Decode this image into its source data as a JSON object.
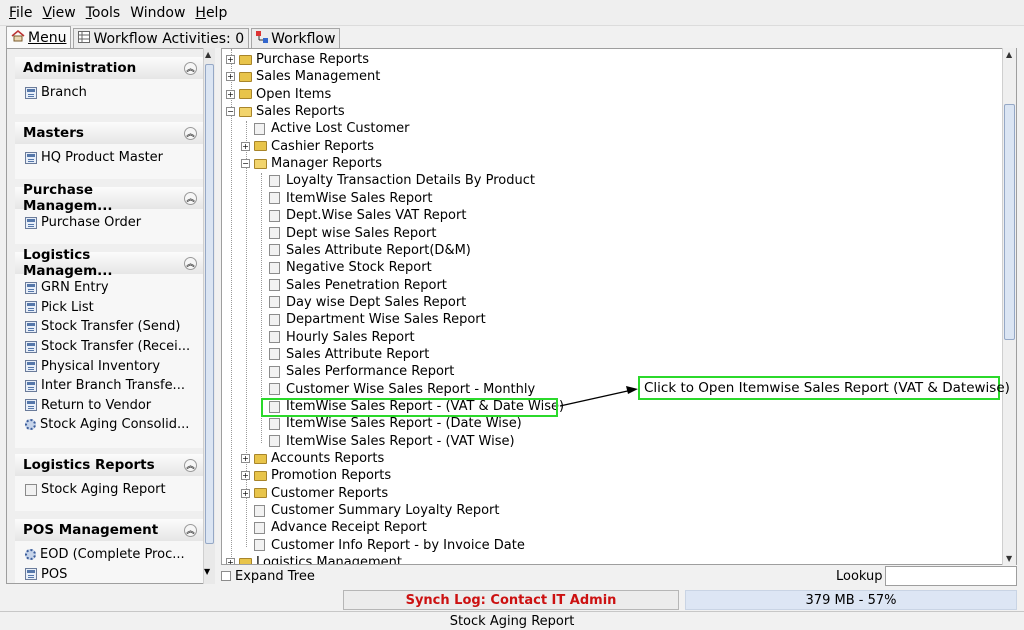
{
  "menubar": {
    "items": [
      {
        "label": "File",
        "mnemonic": "F",
        "rest": "ile"
      },
      {
        "label": "View",
        "mnemonic": "V",
        "rest": "iew"
      },
      {
        "label": "Tools",
        "mnemonic": "T",
        "rest": "ools"
      },
      {
        "label": "Window",
        "mnemonic": "",
        "rest": "Window"
      },
      {
        "label": "Help",
        "mnemonic": "H",
        "rest": "elp"
      }
    ]
  },
  "tabs": [
    {
      "label": "Menu",
      "icon": "home-icon"
    },
    {
      "label": "Workflow Activities: 0",
      "icon": "table-icon"
    },
    {
      "label": "Workflow",
      "icon": "workflow-icon"
    }
  ],
  "sidebar": {
    "sections": [
      {
        "title": "Administration",
        "items": [
          {
            "label": "Branch",
            "icon": "form-icon"
          }
        ]
      },
      {
        "title": "Masters",
        "items": [
          {
            "label": "HQ Product Master",
            "icon": "form-icon"
          }
        ]
      },
      {
        "title": "Purchase Managem...",
        "items": [
          {
            "label": "Purchase Order",
            "icon": "form-icon"
          }
        ]
      },
      {
        "title": "Logistics Managem...",
        "items": [
          {
            "label": "GRN Entry",
            "icon": "form-icon"
          },
          {
            "label": "Pick List",
            "icon": "form-icon"
          },
          {
            "label": "Stock Transfer (Send)",
            "icon": "form-icon"
          },
          {
            "label": "Stock Transfer (Recei...",
            "icon": "form-icon"
          },
          {
            "label": "Physical Inventory",
            "icon": "form-icon"
          },
          {
            "label": "Inter Branch Transfe...",
            "icon": "form-icon"
          },
          {
            "label": "Return to Vendor",
            "icon": "form-icon"
          },
          {
            "label": "Stock Aging Consolid...",
            "icon": "gear-icon"
          }
        ]
      },
      {
        "title": "Logistics Reports",
        "items": [
          {
            "label": "Stock Aging Report",
            "icon": "report-icon"
          }
        ]
      },
      {
        "title": "POS Management",
        "items": [
          {
            "label": "EOD (Complete Proc...",
            "icon": "gear-icon"
          },
          {
            "label": "POS",
            "icon": "form-icon"
          }
        ]
      }
    ]
  },
  "tree": {
    "nodes": [
      {
        "label": "Purchase Reports",
        "type": "folder",
        "expanded": false
      },
      {
        "label": "Sales Management",
        "type": "folder",
        "expanded": false
      },
      {
        "label": "Open Items",
        "type": "folder",
        "expanded": false
      },
      {
        "label": "Sales Reports",
        "type": "folder",
        "expanded": true
      },
      {
        "label": "Active Lost Customer",
        "type": "leaf"
      },
      {
        "label": "Cashier Reports",
        "type": "folder",
        "expanded": false
      },
      {
        "label": "Manager Reports",
        "type": "folder",
        "expanded": true
      },
      {
        "label": "Loyalty Transaction Details By Product",
        "type": "leaf"
      },
      {
        "label": "ItemWise Sales Report",
        "type": "leaf"
      },
      {
        "label": "Dept.Wise Sales VAT Report",
        "type": "leaf"
      },
      {
        "label": "Dept wise Sales Report",
        "type": "leaf"
      },
      {
        "label": "Sales Attribute Report(D&M)",
        "type": "leaf"
      },
      {
        "label": "Negative Stock Report",
        "type": "leaf"
      },
      {
        "label": "Sales Penetration Report",
        "type": "leaf"
      },
      {
        "label": "Day wise Dept Sales Report",
        "type": "leaf"
      },
      {
        "label": "Department Wise Sales Report",
        "type": "leaf"
      },
      {
        "label": "Hourly Sales Report",
        "type": "leaf"
      },
      {
        "label": "Sales Attribute Report",
        "type": "leaf"
      },
      {
        "label": "Sales Performance Report",
        "type": "leaf"
      },
      {
        "label": "Customer Wise Sales Report - Monthly",
        "type": "leaf"
      },
      {
        "label": "ItemWise Sales Report - (VAT & Date Wise)",
        "type": "leaf",
        "highlighted": true
      },
      {
        "label": "ItemWise Sales Report - (Date Wise)",
        "type": "leaf"
      },
      {
        "label": "ItemWise Sales Report - (VAT Wise)",
        "type": "leaf"
      },
      {
        "label": "Accounts Reports",
        "type": "folder",
        "expanded": false
      },
      {
        "label": "Promotion Reports",
        "type": "folder",
        "expanded": false
      },
      {
        "label": "Customer Reports",
        "type": "folder",
        "expanded": false
      },
      {
        "label": "Customer Summary Loyalty Report",
        "type": "leaf"
      },
      {
        "label": "Advance Receipt Report",
        "type": "leaf"
      },
      {
        "label": "Customer Info Report - by Invoice Date",
        "type": "leaf"
      },
      {
        "label": "Logistics Management",
        "type": "folder",
        "expanded": false
      }
    ]
  },
  "callout": {
    "text": "Click to Open Itemwise Sales Report (VAT & Datewise)"
  },
  "bottom": {
    "expand_tree": "Expand Tree",
    "lookup_label": "Lookup",
    "lookup_value": ""
  },
  "status": {
    "synch": "Synch Log: Contact IT Admin",
    "memory": "379 MB - 57%",
    "footer": "Stock Aging Report"
  },
  "colors": {
    "highlight": "#2bd92b",
    "error_text": "#cc1111",
    "memory_bg": "#dde6f4"
  }
}
